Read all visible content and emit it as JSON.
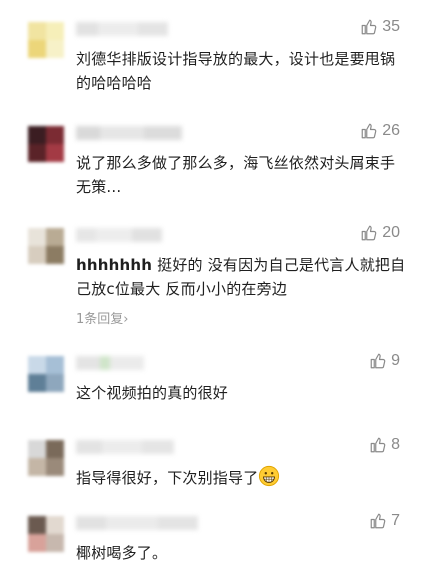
{
  "comments": [
    {
      "likes": "35",
      "text": "刘德华排版设计指导放的最大，设计也是要甩锅的哈哈哈哈"
    },
    {
      "likes": "26",
      "text": "说了那么多做了那么多，海飞丝依然对头屑束手无策..."
    },
    {
      "likes": "20",
      "prefix": "hhhhhhh",
      "text": " 挺好的 没有因为自己是代言人就把自己放c位最大 反而小小的在旁边",
      "replies": "1条回复›"
    },
    {
      "likes": "9",
      "text": "这个视频拍的真的很好"
    },
    {
      "likes": "8",
      "text": "指导得很好，下次别指导了",
      "emoji": "grinning-face-icon"
    },
    {
      "likes": "7",
      "text": "椰树喝多了。"
    }
  ],
  "colors": {
    "like_gray": "#8a8a8a",
    "reply_gray": "#9a9a9a",
    "text": "#1f1f1f"
  }
}
